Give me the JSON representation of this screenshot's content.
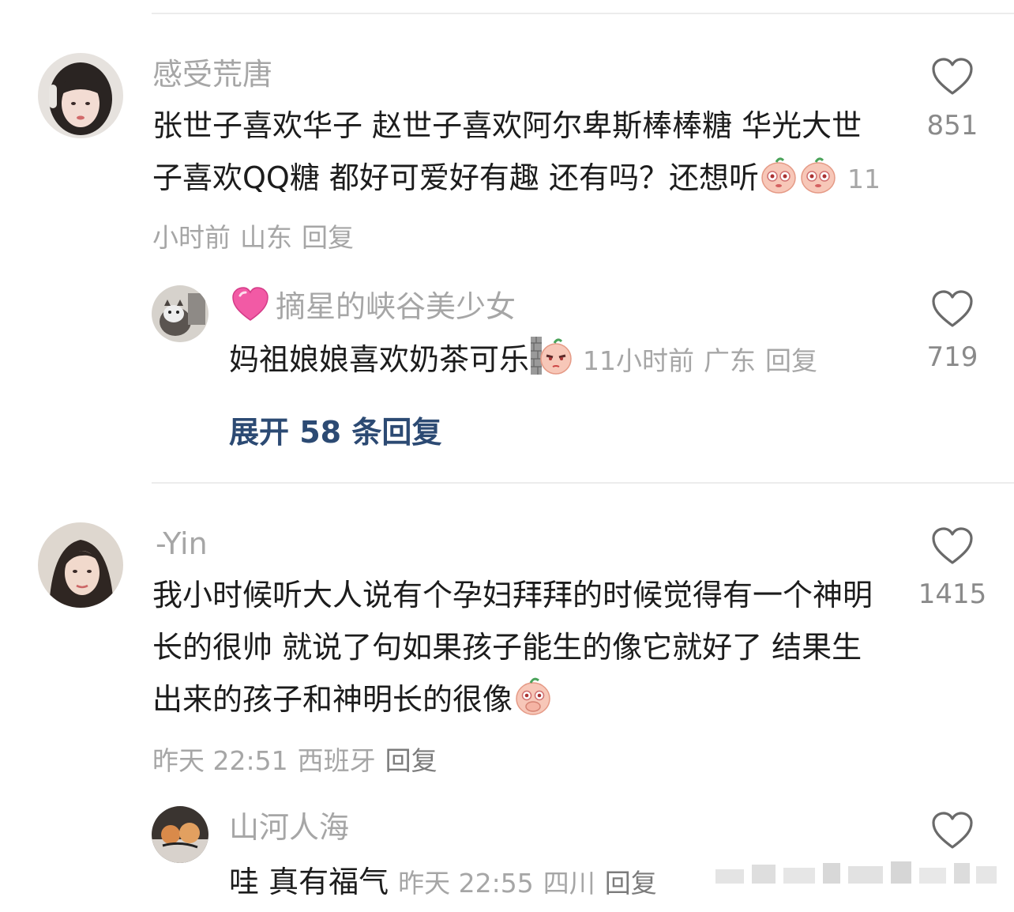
{
  "comments": [
    {
      "username": "感受荒唐",
      "text": "张世子喜欢华子 赵世子喜欢阿尔卑斯棒棒糖 华光大世子喜欢QQ糖 都好可爱好有趣 还有吗？还想听",
      "emojis": [
        "peach-shy-emoji",
        "peach-shy-emoji"
      ],
      "time": "11小时前",
      "location": "山东",
      "reply_label": "回复",
      "likes": "851",
      "replies": [
        {
          "badge": "pink-heart-emoji",
          "username": "摘星的峡谷美少女",
          "text": "妈祖娘娘喜欢奶茶可乐",
          "emojis": [
            "peach-peek-wall-emoji"
          ],
          "time": "11小时前",
          "location": "广东",
          "reply_label": "回复",
          "likes": "719"
        }
      ],
      "expand_label": "展开 58 条回复"
    },
    {
      "username": "-Yin",
      "text": "我小时候听大人说有个孕妇拜拜的时候觉得有一个神明长的很帅 就说了句如果孩子能生的像它就好了 结果生出来的孩子和神明长的很像",
      "emojis": [
        "peach-cover-mouth-emoji"
      ],
      "time": "昨天 22:51",
      "location": "西班牙",
      "reply_label": "回复",
      "likes": "1415",
      "replies": [
        {
          "username": "山河人海",
          "text": "哇 真有福气",
          "time": "昨天 22:55",
          "location": "四川",
          "reply_label": "回复"
        }
      ]
    }
  ]
}
